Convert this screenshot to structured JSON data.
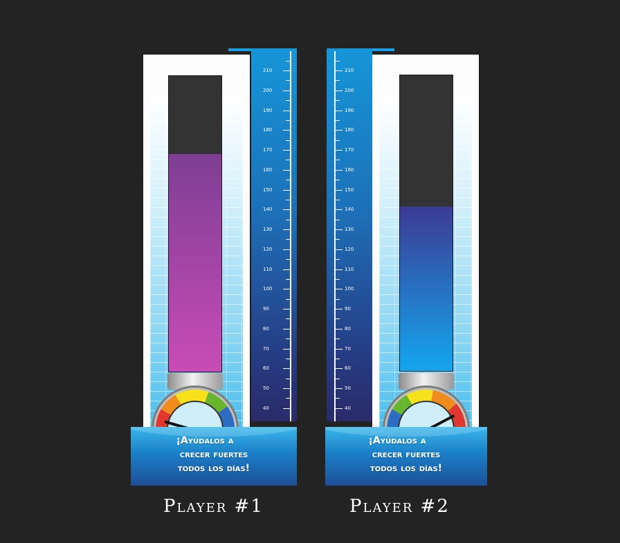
{
  "players": [
    {
      "label": "Player #1",
      "fill_value": 167,
      "gauge_reading": "low",
      "fill_color_top": "#7e3e94",
      "fill_color_bottom": "#c84cb6",
      "banner_lines": [
        "¡Ayúdalos a",
        "crecer fuertes",
        "todos los días!"
      ]
    },
    {
      "label": "Player #2",
      "fill_value": 140,
      "gauge_reading": "high",
      "fill_color_top": "#3b3b93",
      "fill_color_bottom": "#14a6ee",
      "banner_lines": [
        "¡Ayúdalos a",
        "crecer fuertes",
        "todos los días!"
      ]
    }
  ],
  "ruler": {
    "min": 40,
    "max": 210,
    "step": 10,
    "labels": [
      "210",
      "200",
      "190",
      "180",
      "170",
      "160",
      "150",
      "140",
      "130",
      "120",
      "110",
      "100",
      "90",
      "80",
      "70",
      "60",
      "50",
      "40"
    ]
  },
  "tube_scale": {
    "bottom_value": 57,
    "top_value": 207
  }
}
